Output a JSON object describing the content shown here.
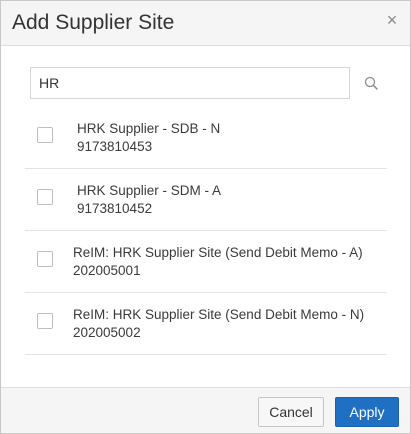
{
  "dialog": {
    "title": "Add Supplier Site",
    "close_glyph": "×"
  },
  "search": {
    "value": "HR",
    "placeholder": "",
    "icon": "search-icon"
  },
  "items": [
    {
      "name": "HRK Supplier - SDB - N",
      "code": "9173810453",
      "checked": false
    },
    {
      "name": "HRK Supplier - SDM - A",
      "code": "9173810452",
      "checked": false
    },
    {
      "name": "ReIM: HRK Supplier Site (Send Debit Memo - A)",
      "code": "202005001",
      "checked": false
    },
    {
      "name": "ReIM: HRK Supplier Site (Send Debit Memo - N)",
      "code": "202005002",
      "checked": false
    }
  ],
  "footer": {
    "cancel_label": "Cancel",
    "apply_label": "Apply"
  },
  "colors": {
    "primary": "#1f6fc3",
    "header_bg": "#f5f5f5"
  }
}
